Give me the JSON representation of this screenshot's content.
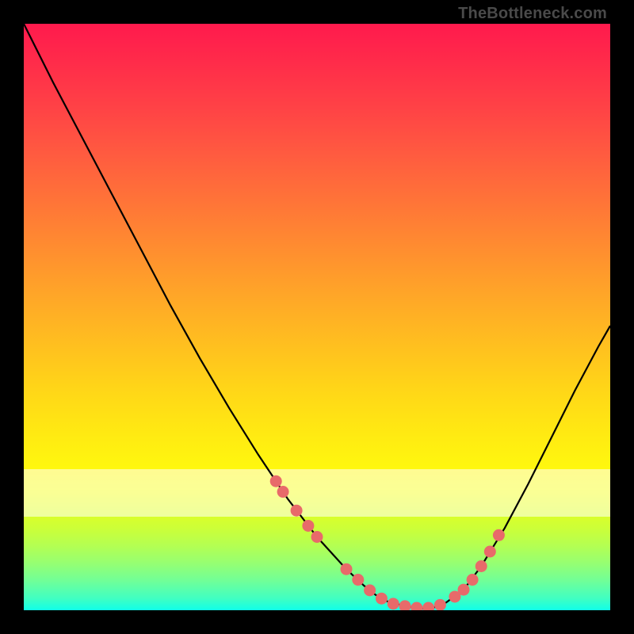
{
  "watermark": "TheBottleneck.com",
  "colors": {
    "background": "#000000",
    "curve": "#000000",
    "marker": "#e86a6a",
    "marker_outline": "#d94f4f"
  },
  "chart_data": {
    "type": "line",
    "title": "",
    "xlabel": "",
    "ylabel": "",
    "xlim": [
      0,
      100
    ],
    "ylim": [
      0,
      100
    ],
    "series": [
      {
        "name": "bottleneck-curve",
        "x": [
          0,
          5,
          10,
          15,
          20,
          25,
          30,
          35,
          40,
          45,
          50,
          55,
          58,
          60,
          62,
          65,
          68,
          70,
          72,
          75,
          78,
          82,
          86,
          90,
          94,
          98,
          100
        ],
        "y": [
          100,
          90,
          80.5,
          71,
          61.5,
          52,
          43,
          34.5,
          26.5,
          19,
          12.5,
          7,
          4.2,
          2.6,
          1.5,
          0.7,
          0.3,
          0.5,
          1.3,
          3.5,
          7.5,
          14,
          21.5,
          29.5,
          37.5,
          45,
          48.5
        ]
      }
    ],
    "markers": {
      "name": "highlight-points",
      "x": [
        43,
        44.2,
        46.5,
        48.5,
        50,
        55,
        57,
        59,
        61,
        63,
        65,
        67,
        69,
        71,
        73.5,
        75,
        76.5,
        78,
        79.5,
        81
      ],
      "y": [
        22,
        20.2,
        17,
        14.4,
        12.5,
        7,
        5.2,
        3.4,
        2,
        1.1,
        0.7,
        0.4,
        0.4,
        0.9,
        2.3,
        3.5,
        5.2,
        7.5,
        10,
        12.8
      ]
    },
    "background_gradient": {
      "orientation": "vertical",
      "stops": [
        {
          "pos": 0.0,
          "color": "#ff1a4d"
        },
        {
          "pos": 0.3,
          "color": "#ff7338"
        },
        {
          "pos": 0.62,
          "color": "#ffd518"
        },
        {
          "pos": 0.8,
          "color": "#f3ff14"
        },
        {
          "pos": 0.92,
          "color": "#96ff72"
        },
        {
          "pos": 1.0,
          "color": "#10ffe8"
        }
      ]
    },
    "white_band": {
      "y_from": 76,
      "y_to": 84
    }
  }
}
